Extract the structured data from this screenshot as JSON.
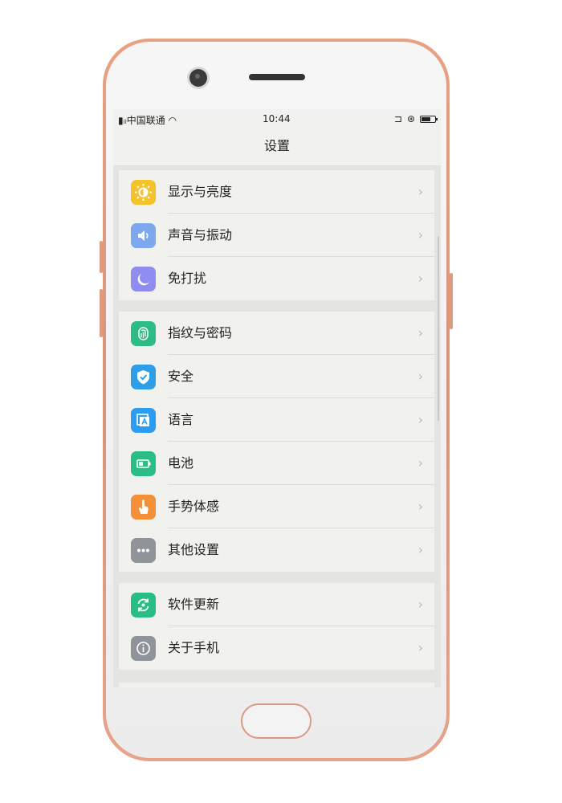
{
  "status_bar": {
    "carrier": "中国联通",
    "time": "10:44"
  },
  "title": "设置",
  "groups": [
    {
      "items": [
        {
          "label": "显示与亮度",
          "icon": "brightness-icon",
          "color": "#f5c22c"
        },
        {
          "label": "声音与振动",
          "icon": "speaker-icon",
          "color": "#7ea8ee"
        },
        {
          "label": "免打扰",
          "icon": "moon-icon",
          "color": "#8f8ef0"
        }
      ]
    },
    {
      "items": [
        {
          "label": "指纹与密码",
          "icon": "fingerprint-icon",
          "color": "#2dbd84"
        },
        {
          "label": "安全",
          "icon": "shield-icon",
          "color": "#2e9fe6"
        },
        {
          "label": "语言",
          "icon": "language-icon",
          "color": "#2c9cf0"
        },
        {
          "label": "电池",
          "icon": "battery-icon",
          "color": "#29be86"
        },
        {
          "label": "手势体感",
          "icon": "hand-icon",
          "color": "#f5903a"
        },
        {
          "label": "其他设置",
          "icon": "more-icon",
          "color": "#8e9499"
        }
      ]
    },
    {
      "items": [
        {
          "label": "软件更新",
          "icon": "update-icon",
          "color": "#27bd84"
        },
        {
          "label": "关于手机",
          "icon": "info-icon",
          "color": "#8e9499"
        }
      ]
    }
  ]
}
